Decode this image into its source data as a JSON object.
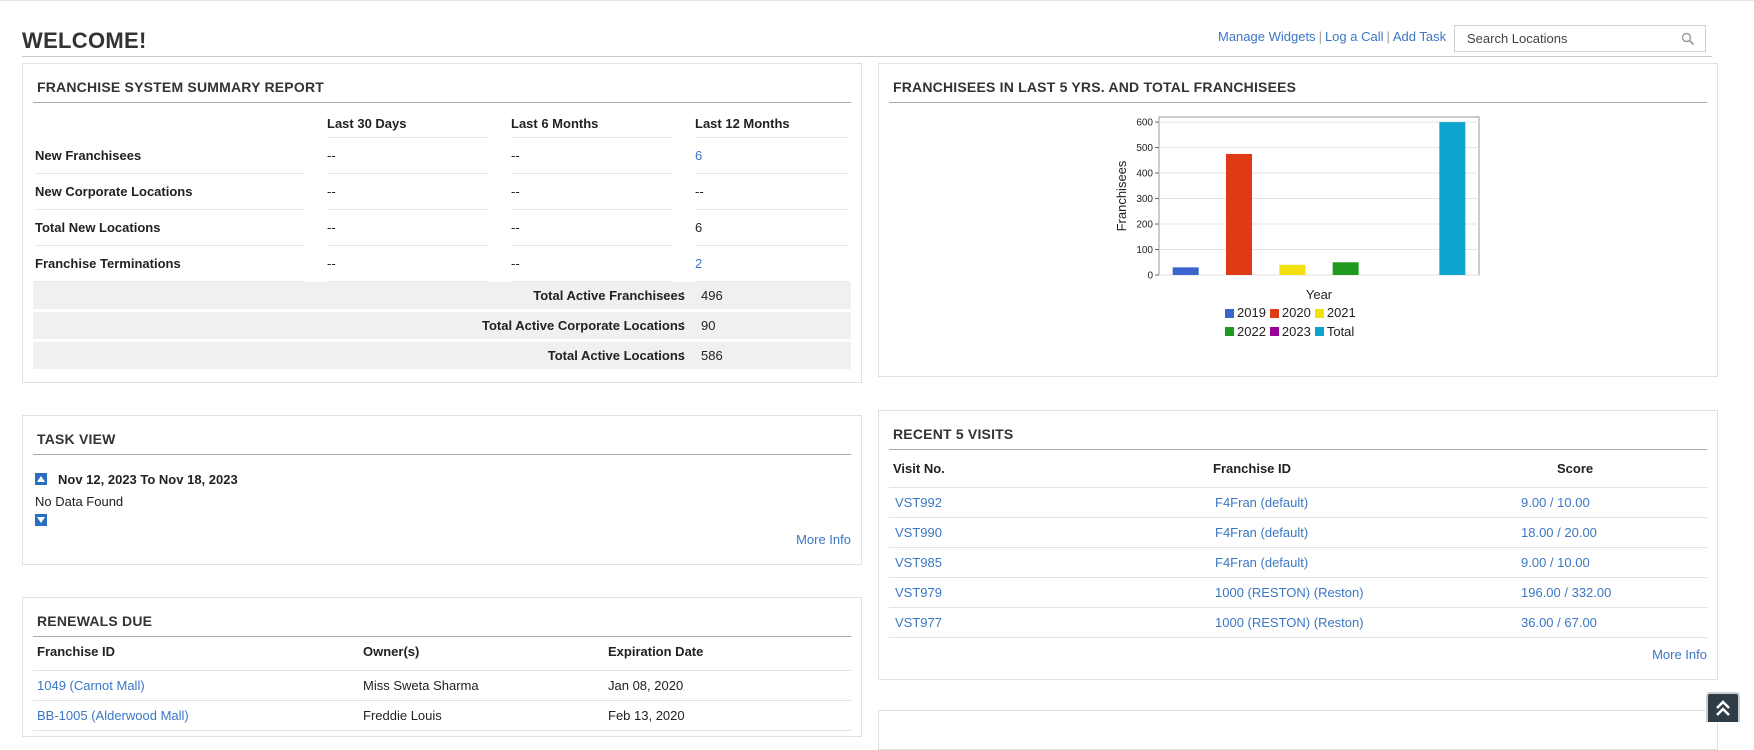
{
  "header": {
    "title": "WELCOME!",
    "actions": [
      "Manage Widgets",
      "Log a Call",
      "Add Task"
    ],
    "search_placeholder": "Search Locations"
  },
  "summary": {
    "title": "FRANCHISE SYSTEM SUMMARY REPORT",
    "columns": [
      "Last 30 Days",
      "Last 6 Months",
      "Last 12 Months"
    ],
    "rows": [
      {
        "label": "New Franchisees",
        "values": [
          "--",
          "--",
          "6"
        ]
      },
      {
        "label": "New Corporate Locations",
        "values": [
          "--",
          "--",
          "--"
        ]
      },
      {
        "label": "Total New Locations",
        "values": [
          "--",
          "--",
          "6"
        ]
      },
      {
        "label": "Franchise Terminations",
        "values": [
          "--",
          "--",
          "2"
        ]
      }
    ],
    "totals": [
      {
        "label": "Total Active Franchisees",
        "sep": ":",
        "value": "496"
      },
      {
        "label": "Total Active Corporate Locations",
        "sep": ":",
        "value": "90"
      },
      {
        "label": "Total Active Locations",
        "sep": ":",
        "value": "586"
      }
    ]
  },
  "franchisees_chart": {
    "title": "FRANCHISEES IN LAST 5 YRS. AND TOTAL FRANCHISEES"
  },
  "chart_data": {
    "type": "bar",
    "categories": [
      "2019",
      "2020",
      "2021",
      "2022",
      "2023",
      "Total"
    ],
    "values": [
      30,
      475,
      40,
      50,
      0,
      600
    ],
    "colors": [
      "#3b64cc",
      "#e03a14",
      "#f2e00e",
      "#1e9a1e",
      "#990099",
      "#0fa3cf"
    ],
    "xlabel": "Year",
    "ylabel": "Franchisees",
    "ylim": [
      0,
      620
    ],
    "yticks": [
      0,
      100,
      200,
      300,
      400,
      500,
      600
    ],
    "grid": true,
    "legend": "bottom"
  },
  "tasks": {
    "title": "TASK VIEW",
    "date_range": "Nov 12, 2023 To Nov 18, 2023",
    "empty": "No Data Found",
    "more": "More Info"
  },
  "visits": {
    "title": "RECENT 5 VISITS",
    "columns": [
      "Visit No.",
      "Franchise ID",
      "Score"
    ],
    "rows": [
      [
        "VST992",
        "F4Fran (default)",
        "9.00 / 10.00"
      ],
      [
        "VST990",
        "F4Fran (default)",
        "18.00 / 20.00"
      ],
      [
        "VST985",
        "F4Fran (default)",
        "9.00 / 10.00"
      ],
      [
        "VST979",
        "1000 (RESTON) (Reston)",
        "196.00 / 332.00"
      ],
      [
        "VST977",
        "1000 (RESTON) (Reston)",
        "36.00 / 67.00"
      ]
    ],
    "more": "More Info"
  },
  "renewals": {
    "title": "RENEWALS DUE",
    "columns": [
      "Franchise ID",
      "Owner(s)",
      "Expiration Date"
    ],
    "rows": [
      [
        "1049 (Carnot Mall)",
        "Miss Sweta Sharma",
        "Jan 08, 2020"
      ],
      [
        "BB-1005 (Alderwood Mall)",
        "Freddie Louis",
        "Feb 13, 2020"
      ]
    ]
  }
}
